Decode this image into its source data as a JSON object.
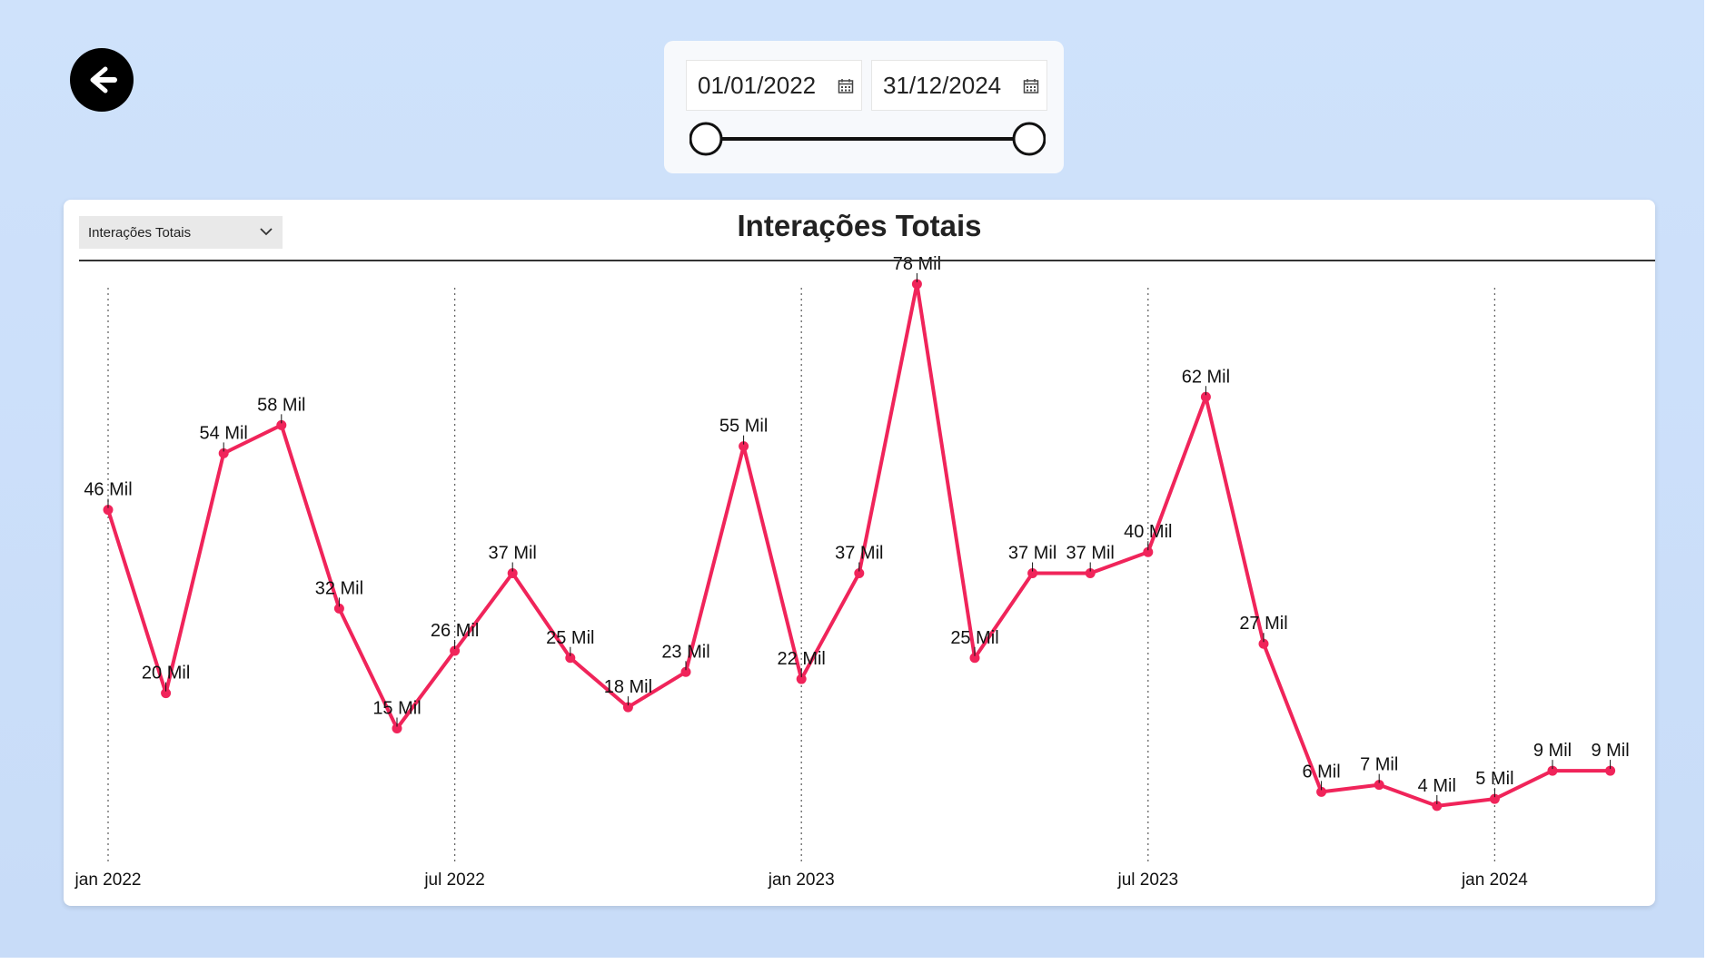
{
  "nav": {
    "back_icon": "arrow-left-icon"
  },
  "date_filter": {
    "start_date": "01/01/2022",
    "end_date": "31/12/2024",
    "calendar_icon": "calendar-icon",
    "slider_start": 0,
    "slider_end": 1
  },
  "chart_panel": {
    "selector_value": "Interações Totais",
    "selector_icon": "chevron-down-icon"
  },
  "colors": {
    "line": "#f0245a",
    "background": "#cfe2fb"
  },
  "chart_data": {
    "type": "line",
    "title": "Interações Totais",
    "xlabel": "",
    "ylabel": "",
    "grid": "vertical dotted at ticks",
    "x": [
      "2022-01",
      "2022-02",
      "2022-03",
      "2022-04",
      "2022-05",
      "2022-06",
      "2022-07",
      "2022-08",
      "2022-09",
      "2022-10",
      "2022-11",
      "2022-12",
      "2023-01",
      "2023-02",
      "2023-03",
      "2023-04",
      "2023-05",
      "2023-06",
      "2023-07",
      "2023-08",
      "2023-09",
      "2023-10",
      "2023-11",
      "2023-12",
      "2024-01",
      "2024-02",
      "2024-03"
    ],
    "values": [
      46,
      20,
      54,
      58,
      32,
      15,
      26,
      37,
      25,
      18,
      23,
      55,
      22,
      37,
      78,
      25,
      37,
      37,
      40,
      62,
      27,
      6,
      7,
      4,
      5,
      9,
      9
    ],
    "labels": [
      "46 Mil",
      "20 Mil",
      "54 Mil",
      "58 Mil",
      "32 Mil",
      "15 Mil",
      "26 Mil",
      "37 Mil",
      "25 Mil",
      "18 Mil",
      "23 Mil",
      "55 Mil",
      "22 Mil",
      "37 Mil",
      "78 Mil",
      "25 Mil",
      "37 Mil",
      "37 Mil",
      "40 Mil",
      "62 Mil",
      "27 Mil",
      "6 Mil",
      "7 Mil",
      "4 Mil",
      "5 Mil",
      "9 Mil",
      "9 Mil"
    ],
    "x_ticks": [
      {
        "index": 0,
        "label": "jan 2022"
      },
      {
        "index": 6,
        "label": "jul 2022"
      },
      {
        "index": 12,
        "label": "jan 2023"
      },
      {
        "index": 18,
        "label": "jul 2023"
      },
      {
        "index": 24,
        "label": "jan 2024"
      }
    ]
  }
}
